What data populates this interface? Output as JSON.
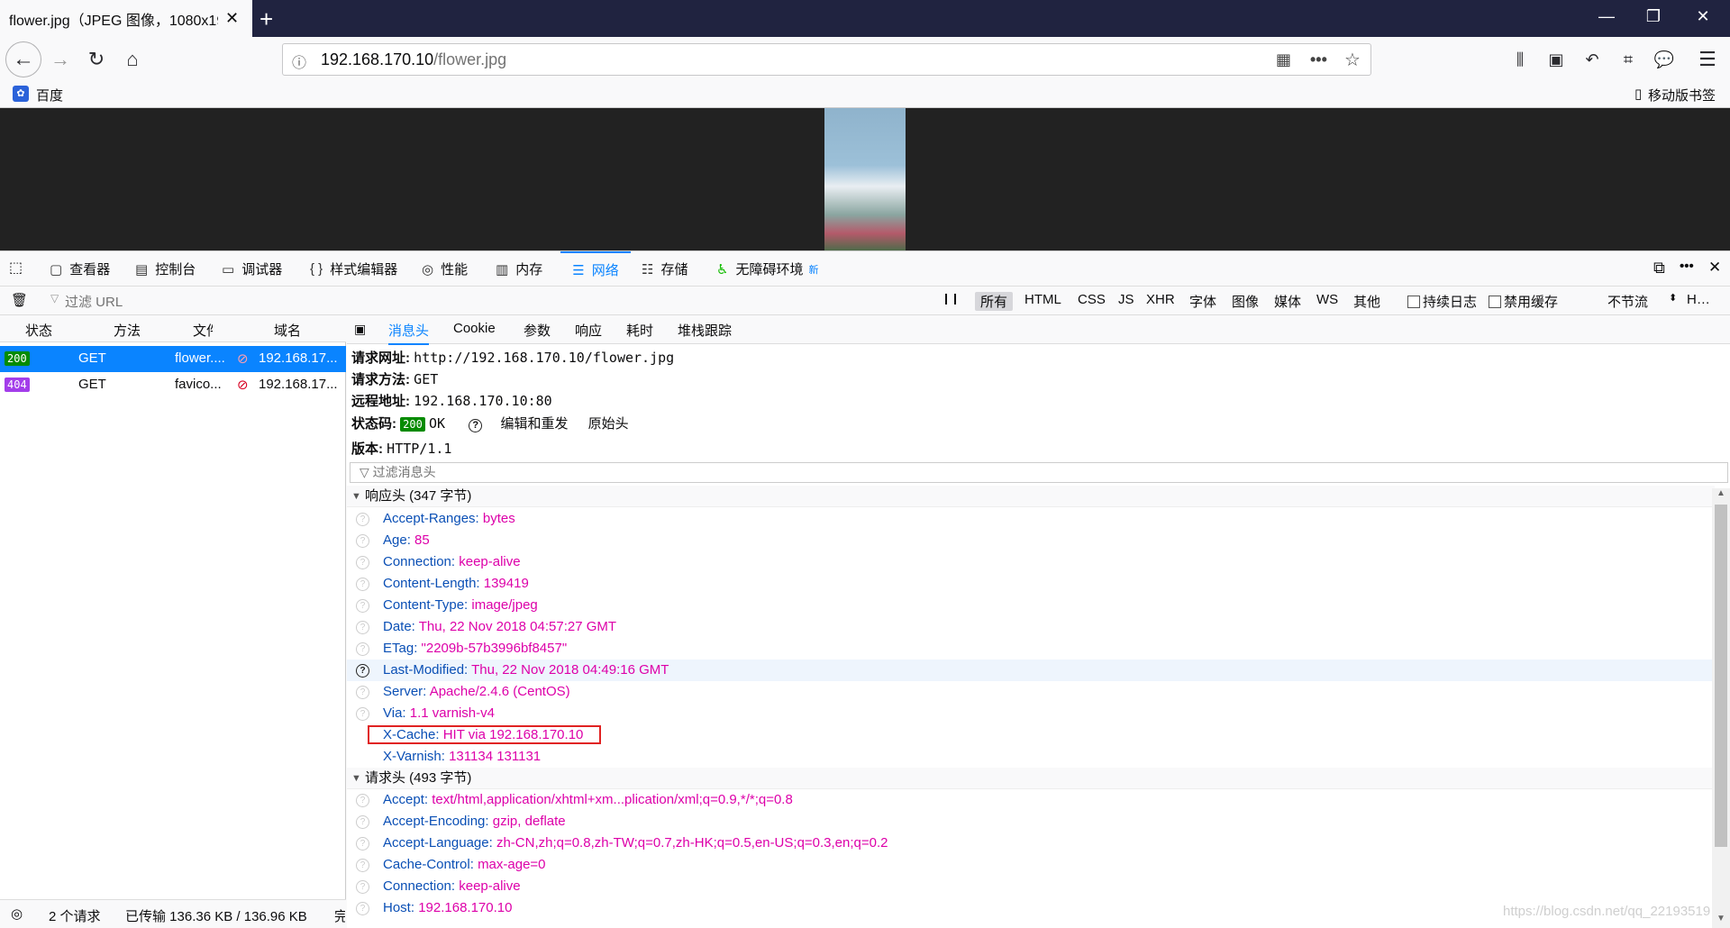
{
  "tab": {
    "title": "flower.jpg（JPEG 图像，1080x19…",
    "close": "✕",
    "new": "+"
  },
  "window": {
    "minimize": "—",
    "restore": "❐",
    "close": "✕"
  },
  "url": {
    "host": "192.168.170.10",
    "path": "/flower.jpg"
  },
  "bookmarks": {
    "baidu": "百度",
    "mobile": "移动版书签"
  },
  "devtools": {
    "tabs": [
      "查看器",
      "控制台",
      "调试器",
      "样式编辑器",
      "性能",
      "内存",
      "网络",
      "存储",
      "无障碍环境"
    ],
    "tab_icons": [
      "▢",
      "▤",
      "▭",
      "{ }",
      "◎",
      "▥",
      "☰",
      "☷",
      "♿"
    ],
    "new_label": "新",
    "selected_tab": "网络"
  },
  "filterbar": {
    "placeholder": "过滤 URL",
    "pause": "❙❙",
    "types": [
      "所有",
      "HTML",
      "CSS",
      "JS",
      "XHR",
      "字体",
      "图像",
      "媒体",
      "WS",
      "其他"
    ],
    "persist_log": "持续日志",
    "disable_cache": "禁用缓存",
    "throttle": "不节流",
    "har": "H…"
  },
  "reqlist": {
    "columns": [
      "状态",
      "方法",
      "文件",
      "域名"
    ],
    "rows": [
      {
        "status": "200",
        "method": "GET",
        "file": "flower....",
        "domain": "192.168.17...",
        "color": "#058b00"
      },
      {
        "status": "404",
        "method": "GET",
        "file": "favico...",
        "domain": "192.168.17...",
        "color": "#a33dea"
      }
    ]
  },
  "status": {
    "count": "2 个请求",
    "transferred": "已传输 136.36 KB / 136.96 KB",
    "finish": "完"
  },
  "detail": {
    "tabs": [
      "消息头",
      "Cookie",
      "参数",
      "响应",
      "耗时",
      "堆栈跟踪"
    ],
    "request_url_k": "请求网址:",
    "request_url_v": "http://192.168.170.10/flower.jpg",
    "method_k": "请求方法:",
    "method_v": "GET",
    "remote_k": "远程地址:",
    "remote_v": "192.168.170.10:80",
    "status_k": "状态码:",
    "status_code": "200",
    "status_text": "OK",
    "edit_resend": "编辑和重发",
    "raw_headers": "原始头",
    "version_k": "版本:",
    "version_v": "HTTP/1.1",
    "filter_placeholder": "过滤消息头",
    "resp_section": "响应头 (347 字节)",
    "resp_headers": [
      {
        "n": "Accept-Ranges:",
        "v": "bytes"
      },
      {
        "n": "Age:",
        "v": "85"
      },
      {
        "n": "Connection:",
        "v": "keep-alive"
      },
      {
        "n": "Content-Length:",
        "v": "139419"
      },
      {
        "n": "Content-Type:",
        "v": "image/jpeg"
      },
      {
        "n": "Date:",
        "v": "Thu, 22 Nov 2018 04:57:27 GMT"
      },
      {
        "n": "ETag:",
        "v": "\"2209b-57b3996bf8457\""
      },
      {
        "n": "Last-Modified:",
        "v": "Thu, 22 Nov 2018 04:49:16 GMT"
      },
      {
        "n": "Server:",
        "v": "Apache/2.4.6 (CentOS)"
      },
      {
        "n": "Via:",
        "v": "1.1 varnish-v4"
      },
      {
        "n": "X-Cache:",
        "v": "HIT via 192.168.170.10"
      },
      {
        "n": "X-Varnish:",
        "v": "131134 131131"
      }
    ],
    "req_section": "请求头 (493 字节)",
    "req_headers": [
      {
        "n": "Accept:",
        "v": "text/html,application/xhtml+xm...plication/xml;q=0.9,*/*;q=0.8"
      },
      {
        "n": "Accept-Encoding:",
        "v": "gzip, deflate"
      },
      {
        "n": "Accept-Language:",
        "v": "zh-CN,zh;q=0.8,zh-TW;q=0.7,zh-HK;q=0.5,en-US;q=0.3,en;q=0.2"
      },
      {
        "n": "Cache-Control:",
        "v": "max-age=0"
      },
      {
        "n": "Connection:",
        "v": "keep-alive"
      },
      {
        "n": "Host:",
        "v": "192.168.170.10"
      }
    ]
  },
  "watermark": "https://blog.csdn.net/qq_22193519"
}
